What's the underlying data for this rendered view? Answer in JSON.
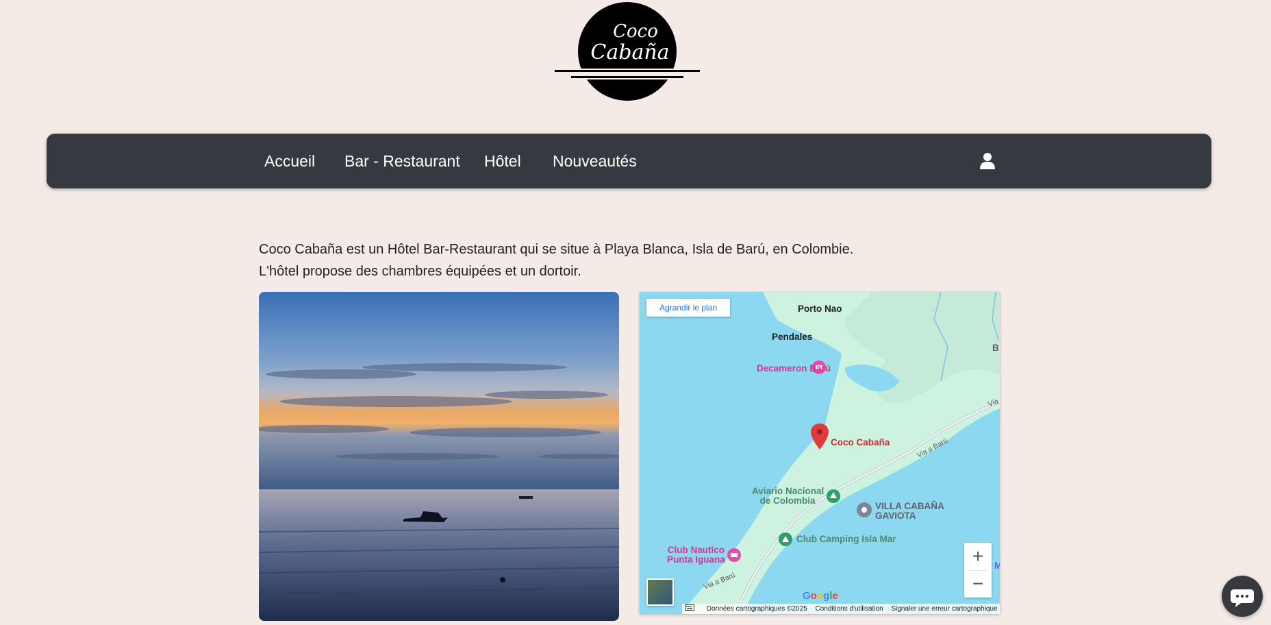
{
  "logo": {
    "line1": "Coco",
    "line2": "Cabaña"
  },
  "nav": {
    "items": [
      "Accueil",
      "Bar - Restaurant",
      "Hôtel",
      "Nouveautés"
    ],
    "user_icon": "user-icon"
  },
  "intro": {
    "line1": "Coco Cabaña est un Hôtel Bar-Restaurant qui se situe à Playa Blanca, Isla de Barú, en Colombie.",
    "line2": "L'hôtel propose des chambres équipées et un dortoir."
  },
  "map": {
    "enlarge_label": "Agrandir le plan",
    "places": {
      "porto_nao": "Porto Nao",
      "pendales": "Pendales",
      "decameron": "Decameron Barú",
      "coco": "Coco Cabaña",
      "aviario_1": "Aviario Nacional",
      "aviario_2": "de Colombia",
      "villa_1": "VILLA CABAÑA",
      "villa_2": "GAVIOTA",
      "camping": "Club Camping Isla Mar",
      "club_1": "Club Nautico",
      "club_2": "Punta Iguana",
      "edge_b": "B",
      "edge_m": "M"
    },
    "roads": {
      "via_baru_1": "Via a Barú",
      "via_baru_2": "Via a Barú",
      "via_edge": "Via"
    },
    "zoom_in": "+",
    "zoom_out": "−",
    "google": "Google",
    "footer": {
      "data": "Données cartographiques ©2025",
      "terms": "Conditions d'utilisation",
      "report": "Signaler une erreur cartographique"
    },
    "colors": {
      "water": "#8cd8f0",
      "land": "#cdf2e0",
      "road": "#b9c7cf"
    }
  },
  "chat_icon": "chat-bubble-icon"
}
